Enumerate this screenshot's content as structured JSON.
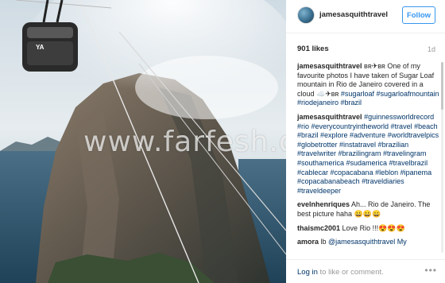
{
  "photo": {
    "watermark": "www.farfesh.com",
    "cable_car_label": "YA"
  },
  "post": {
    "username": "jamesasquithtravel",
    "follow_label": "Follow",
    "likes": "901 likes",
    "age": "1d"
  },
  "comments": [
    {
      "user": "jamesasquithtravel",
      "text": " ʙʀ✈ʙʀ One of my favourite photos I have taken of Sugar Loaf mountain in Rio de Janeiro covered in a cloud ☁️✈ʙʀ ",
      "tags": "#sugarloaf #sugarloafmountain #riodejaneiro #brazil"
    },
    {
      "user": "jamesasquithtravel",
      "text": " ",
      "tags": "#guinnessworldrecord #rio #everycountryintheworld #travel #beach #brazil #explore #adventure #worldtravelpics #globetrotter #instatravel #brazilian #travelwriter #brazilingram #travelingram #southamerica #sudamerica #travelbrazil #cablecar #copacabana #leblon #ipanema #copacabanabeach #traveldiaries #traveldeeper"
    },
    {
      "user": "evelnhenriques",
      "text": " Ah... Rio de Janeiro. The best picture haha 😀😀😀",
      "tags": ""
    },
    {
      "user": "thaismc2001",
      "text": " Love Rio !!!😍😍😍",
      "tags": ""
    },
    {
      "user": "amora",
      "text": " lb ",
      "tags": "@jamesasquithtravel My"
    }
  ],
  "footer": {
    "login_link": "Log in",
    "login_rest": " to like or comment.",
    "more": "•••"
  }
}
